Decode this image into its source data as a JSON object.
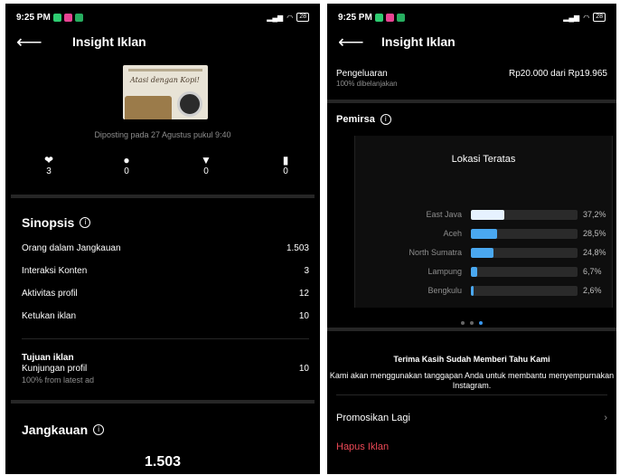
{
  "status": {
    "time": "9:25 PM",
    "battery": "28"
  },
  "left": {
    "header": {
      "title": "Insight Iklan"
    },
    "post": {
      "caption": "Atasi dengan Kopi!",
      "posted": "Diposting pada 27 Agustus pukul 9:40"
    },
    "stats": [
      {
        "icon": "heart-icon",
        "value": "3"
      },
      {
        "icon": "comment-icon",
        "value": "0"
      },
      {
        "icon": "share-icon",
        "value": "0"
      },
      {
        "icon": "bookmark-icon",
        "value": "0"
      }
    ],
    "sinopsis": {
      "title": "Sinopsis",
      "rows": [
        {
          "label": "Orang dalam Jangkauan",
          "value": "1.503"
        },
        {
          "label": "Interaksi Konten",
          "value": "3"
        },
        {
          "label": "Aktivitas profil",
          "value": "12"
        },
        {
          "label": "Ketukan iklan",
          "value": "10"
        }
      ]
    },
    "goal": {
      "title": "Tujuan iklan",
      "name": "Kunjungan profil",
      "sub": "100% from latest ad",
      "value": "10"
    },
    "reach": {
      "title": "Jangkauan",
      "value": "1.503"
    }
  },
  "right": {
    "header": {
      "title": "Insight Iklan"
    },
    "spend": {
      "label": "Pengeluaran",
      "sub": "100% dibelanjakan",
      "amount": "Rp20.000 dari Rp19.965"
    },
    "audience": {
      "title": "Pemirsa"
    },
    "top_locations": {
      "title": "Lokasi Teratas",
      "items": [
        {
          "name": "East Java",
          "value": 37.2,
          "label": "37,2%",
          "color": "#e6f2ff"
        },
        {
          "name": "Aceh",
          "value": 28.5,
          "label": "28,5%",
          "color": "#4aa8f0"
        },
        {
          "name": "North Sumatra",
          "value": 24.8,
          "label": "24,8%",
          "color": "#4aa8f0"
        },
        {
          "name": "Lampung",
          "value": 6.7,
          "label": "6,7%",
          "color": "#4aa8f0"
        },
        {
          "name": "Bengkulu",
          "value": 2.6,
          "label": "2,6%",
          "color": "#4aa8f0"
        }
      ]
    },
    "feedback": {
      "title": "Terima Kasih Sudah Memberi Tahu Kami",
      "text": "Kami akan menggunakan tanggapan Anda untuk membantu menyempurnakan Instagram."
    },
    "menu": {
      "promote": "Promosikan Lagi",
      "delete": "Hapus Iklan"
    }
  }
}
